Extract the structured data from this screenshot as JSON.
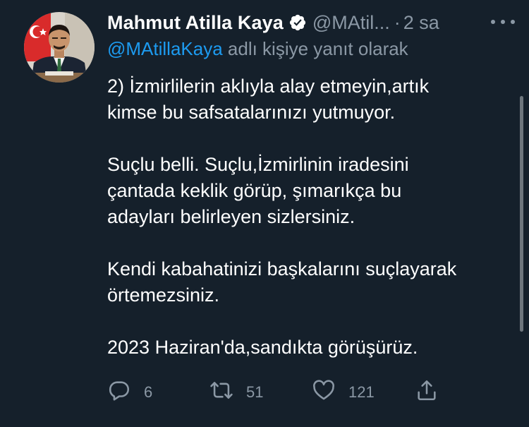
{
  "author": {
    "display_name": "Mahmut Atilla Kaya",
    "handle": "@MAtil...",
    "separator": "·",
    "time": "2 sa",
    "avatar_icon": "profile-photo-avatar",
    "verified_icon": "verified-badge-icon"
  },
  "reply_context": {
    "mention": "@MAtillaKaya",
    "suffix": " adlı kişiye yanıt olarak"
  },
  "tweet_text": {
    "p1_line1": "2) İzmirlilerin aklıyla alay etmeyin,artık",
    "p1_line2": "kimse bu safsatalarınızı yutmuyor.",
    "p2_line1": "Suçlu belli. Suçlu,İzmirlinin iradesini",
    "p2_line2": "çantada keklik görüp, şımarıkça bu",
    "p2_line3": "adayları belirleyen sizlersiniz.",
    "p3_line1": "Kendi kabahatinizi başkalarını suçlayarak",
    "p3_line2": "örtemezsiniz.",
    "p4_line1": "2023 Haziran'da,sandıkta görüşürüz."
  },
  "actions": {
    "reply_count": "6",
    "retweet_count": "51",
    "like_count": "121",
    "reply_icon": "reply-icon",
    "retweet_icon": "retweet-icon",
    "like_icon": "heart-icon",
    "share_icon": "share-icon"
  },
  "colors": {
    "background": "#15202b",
    "secondary_text": "#8b98a5",
    "accent": "#1d9bf0"
  }
}
